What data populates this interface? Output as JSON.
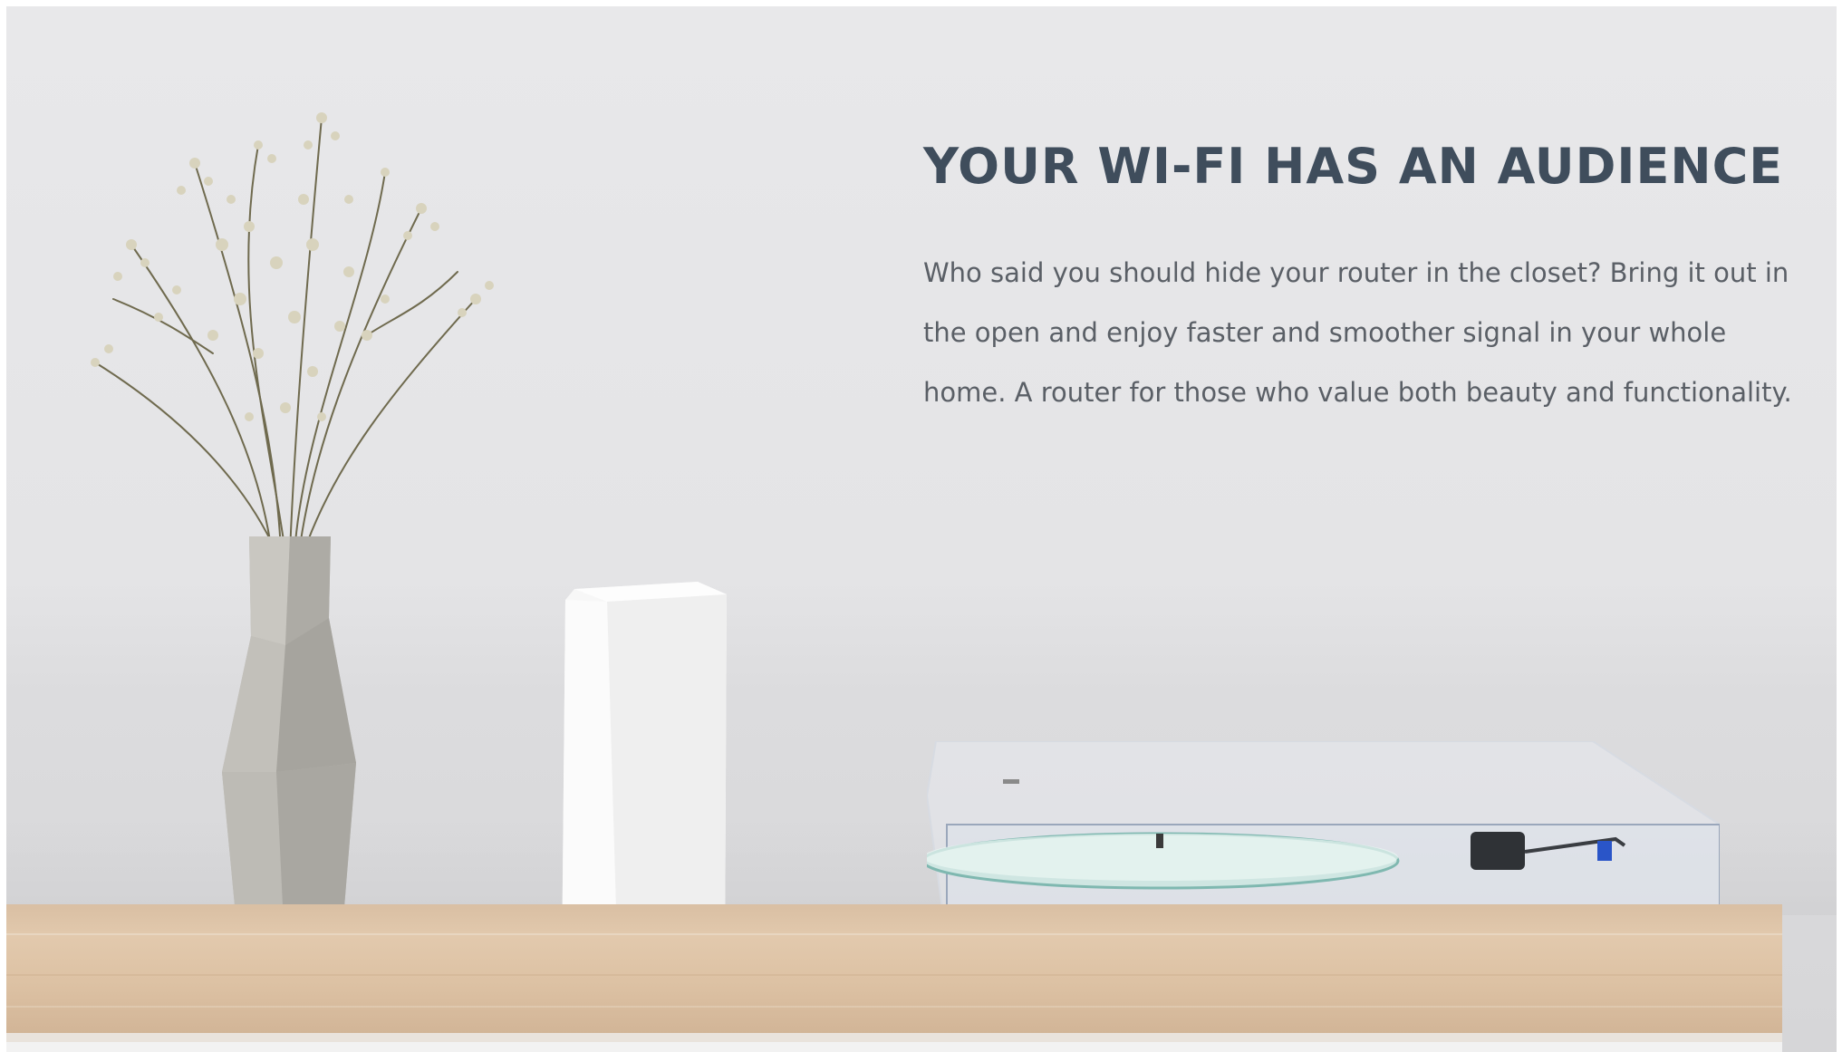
{
  "hero": {
    "headline": "YOUR WI-FI HAS AN AUDIENCE",
    "body": "Who said you should hide your router in the closet? Bring it out in the open and enjoy faster and smoother signal in your whole home. A router for those who value both beauty and functionality.",
    "colors": {
      "headline": "#3f4d5c",
      "body": "#5a5f66",
      "wall": "#e6e6e8",
      "shelf": "#dcc1a4"
    }
  }
}
